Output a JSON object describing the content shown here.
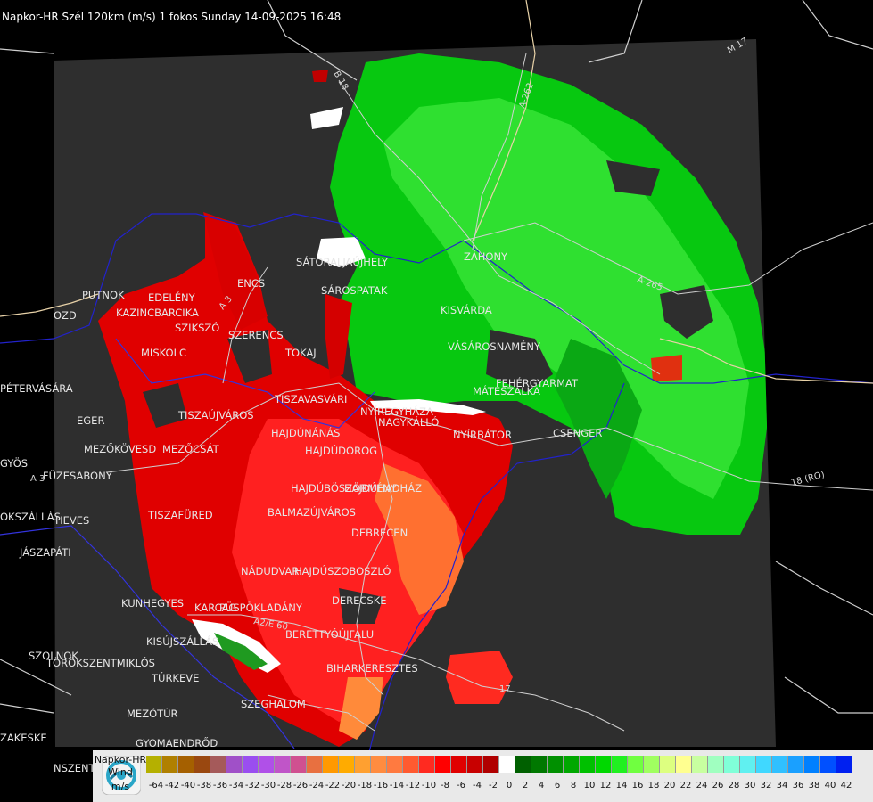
{
  "title": "Napkor-HR Szél 120km (m/s) 1 fokos Sunday 14-09-2025 16:48",
  "places": [
    "PUTNOK",
    "EDELÉNY",
    "KAZINCBARCIKA",
    "SZIKSZÓ",
    "SZERENCS",
    "ENCS",
    "SÁTORALJAÚJHELY",
    "SÁROSPATAK",
    "KISVÁRDA",
    "ZÁHONY",
    "VÁSÁROSNAMÉNY",
    "MÁTÉSZALKA",
    "FEHÉRGYARMAT",
    "CSENGER",
    "NYÍRBÁTOR",
    "NAGYKÁLLÓ",
    "NYÍREGYHÁZA",
    "TOKAJ",
    "TISZAVASVÁRI",
    "MISKOLC",
    "TISZAÚJVÁROS",
    "EGER",
    "MEZŐKÖVESD",
    "MEZŐCSÁT",
    "HAJDÚNÁNÁS",
    "HAJDÚDOROG",
    "HAJDÚBÖSZÖRMÉNY",
    "HAJDÚHADHÁZ",
    "BALMAZÚJVÁROS",
    "DEBRECEN",
    "TISZAFÜRED",
    "FÜZESABONY",
    "HEVES",
    "JÁSZAPÁTI",
    "KUNHEGYES",
    "KARCAG",
    "PÜSPÖKLADÁNY",
    "NÁDUDVAR",
    "HAJDÚSZOBOSZLÓ",
    "DERECSKE",
    "BERETTYÓÚJFALU",
    "BIHARKERESZTES",
    "KISÚJSZÁLLÁS",
    "TÖRÖKSZENTMIKLÓS",
    "TÚRKEVE",
    "SZEGHALOM",
    "MEZŐTÚR",
    "SZOLNOK",
    "GYOMAENDRŐD",
    "PÉTERVÁSÁRA",
    "GYÖS",
    "OKSZÁLLÁS",
    "ZAKESKE",
    "OZD",
    "NSZENT"
  ],
  "roads": [
    "B 18",
    "A-262",
    "M 17",
    "A-265",
    "A 3",
    "18 (RO)",
    "A 3",
    "17",
    "A2/E 60"
  ],
  "legend": {
    "line1": "Napkor-HR",
    "line2": "Wind",
    "line3": "m/s",
    "ticks": [
      "-64",
      "-42",
      "-40",
      "-38",
      "-36",
      "-34",
      "-32",
      "-30",
      "-28",
      "-26",
      "-24",
      "-22",
      "-20",
      "-18",
      "-16",
      "-14",
      "-12",
      "-10",
      "-8",
      "-6",
      "-4",
      "-2",
      "0",
      "2",
      "4",
      "6",
      "8",
      "10",
      "12",
      "14",
      "16",
      "18",
      "20",
      "22",
      "24",
      "26",
      "28",
      "30",
      "32",
      "34",
      "36",
      "38",
      "40",
      "42"
    ],
    "colors": [
      "#b5b000",
      "#b08000",
      "#a56000",
      "#9a4810",
      "#a55a5a",
      "#a050c8",
      "#9a4ef0",
      "#b050e8",
      "#c055c8",
      "#d05090",
      "#e87040",
      "#ff9900",
      "#ffab00",
      "#ffa030",
      "#ff8c40",
      "#ff7a40",
      "#ff5a30",
      "#ff2a20",
      "#ff0000",
      "#e00000",
      "#c80000",
      "#b00000",
      "#ffffff",
      "#006000",
      "#007800",
      "#009000",
      "#00a800",
      "#00c000",
      "#00d800",
      "#20f020",
      "#70ff40",
      "#a0ff60",
      "#ddff80",
      "#ffff90",
      "#c8ffa0",
      "#a0ffc0",
      "#80ffd8",
      "#60f0f0",
      "#40d8ff",
      "#30c0ff",
      "#1aa0ff",
      "#0080ff",
      "#0050ff",
      "#0020f0"
    ]
  }
}
